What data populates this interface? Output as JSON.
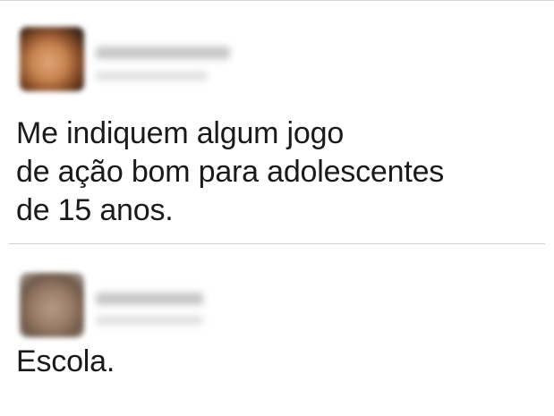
{
  "posts": [
    {
      "author_name": "",
      "meta": "",
      "text": "Me indiquem algum jogo\nde ação bom para adolescentes\nde 15 anos."
    },
    {
      "author_name": "",
      "meta": "",
      "text": "Escola."
    }
  ]
}
